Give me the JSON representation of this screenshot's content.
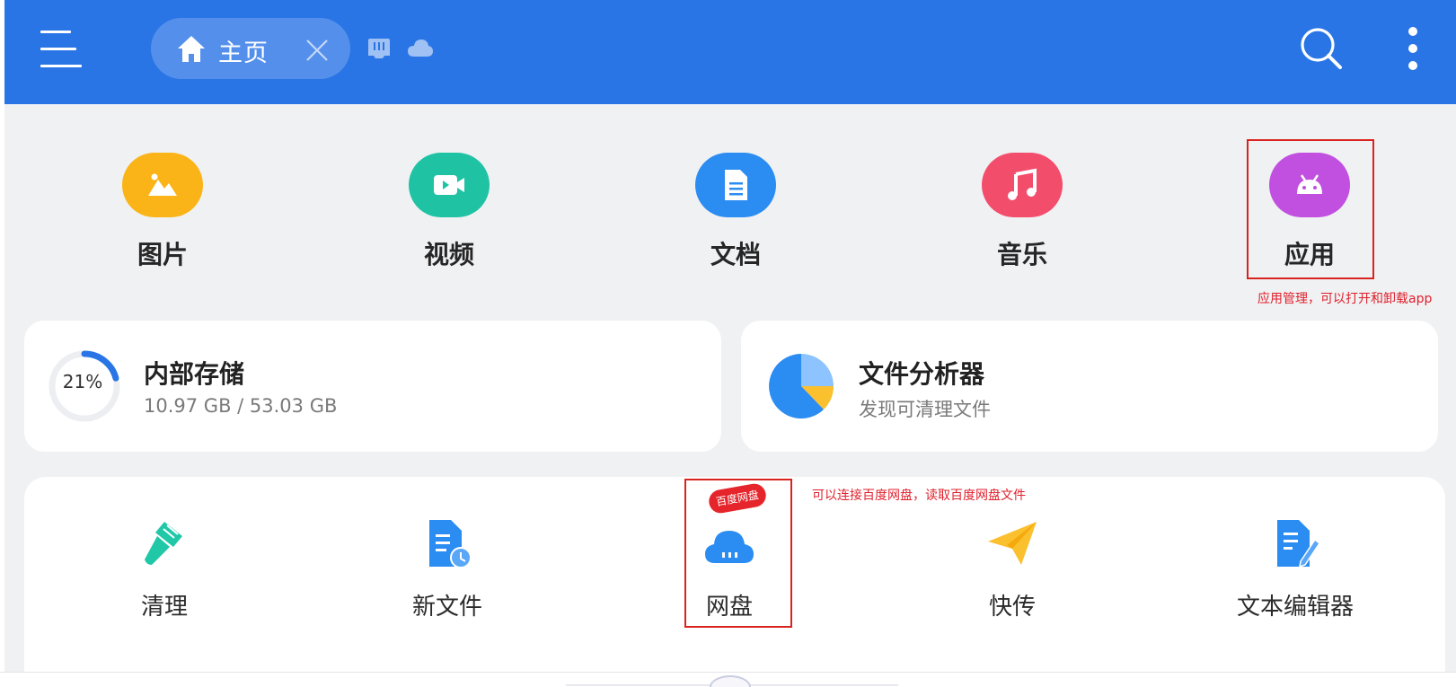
{
  "appbar": {
    "tab_label": "主页",
    "bg_color": "#2a75e6",
    "icons": [
      "menu-icon",
      "home-icon",
      "close-icon",
      "sd-card-icon",
      "cloud-icon",
      "search-icon",
      "more-vert-icon"
    ]
  },
  "categories": [
    {
      "label": "图片",
      "icon": "image-icon",
      "color": "#fbb417"
    },
    {
      "label": "视频",
      "icon": "video-icon",
      "color": "#1fc3a4"
    },
    {
      "label": "文档",
      "icon": "document-icon",
      "color": "#2b8cf2"
    },
    {
      "label": "音乐",
      "icon": "music-icon",
      "color": "#f34d6c"
    },
    {
      "label": "应用",
      "icon": "android-icon",
      "color": "#c14fe0"
    }
  ],
  "storage": {
    "title": "内部存储",
    "usage": "10.97 GB / 53.03 GB",
    "percent_label": "21%",
    "percent_value": 21
  },
  "analyzer": {
    "title": "文件分析器",
    "subtitle": "发现可清理文件"
  },
  "tools": [
    {
      "label": "清理",
      "icon": "broom-icon"
    },
    {
      "label": "新文件",
      "icon": "recent-file-icon"
    },
    {
      "label": "网盘",
      "icon": "cloud-drive-icon",
      "badge": "百度网盘"
    },
    {
      "label": "快传",
      "icon": "paper-plane-icon"
    },
    {
      "label": "文本编辑器",
      "icon": "text-editor-icon"
    }
  ],
  "annotations": {
    "apps": "应用管理，可以打开和卸载app",
    "netdisk": "可以连接百度网盘，读取百度网盘文件"
  },
  "annotation_color": "#d9231f"
}
